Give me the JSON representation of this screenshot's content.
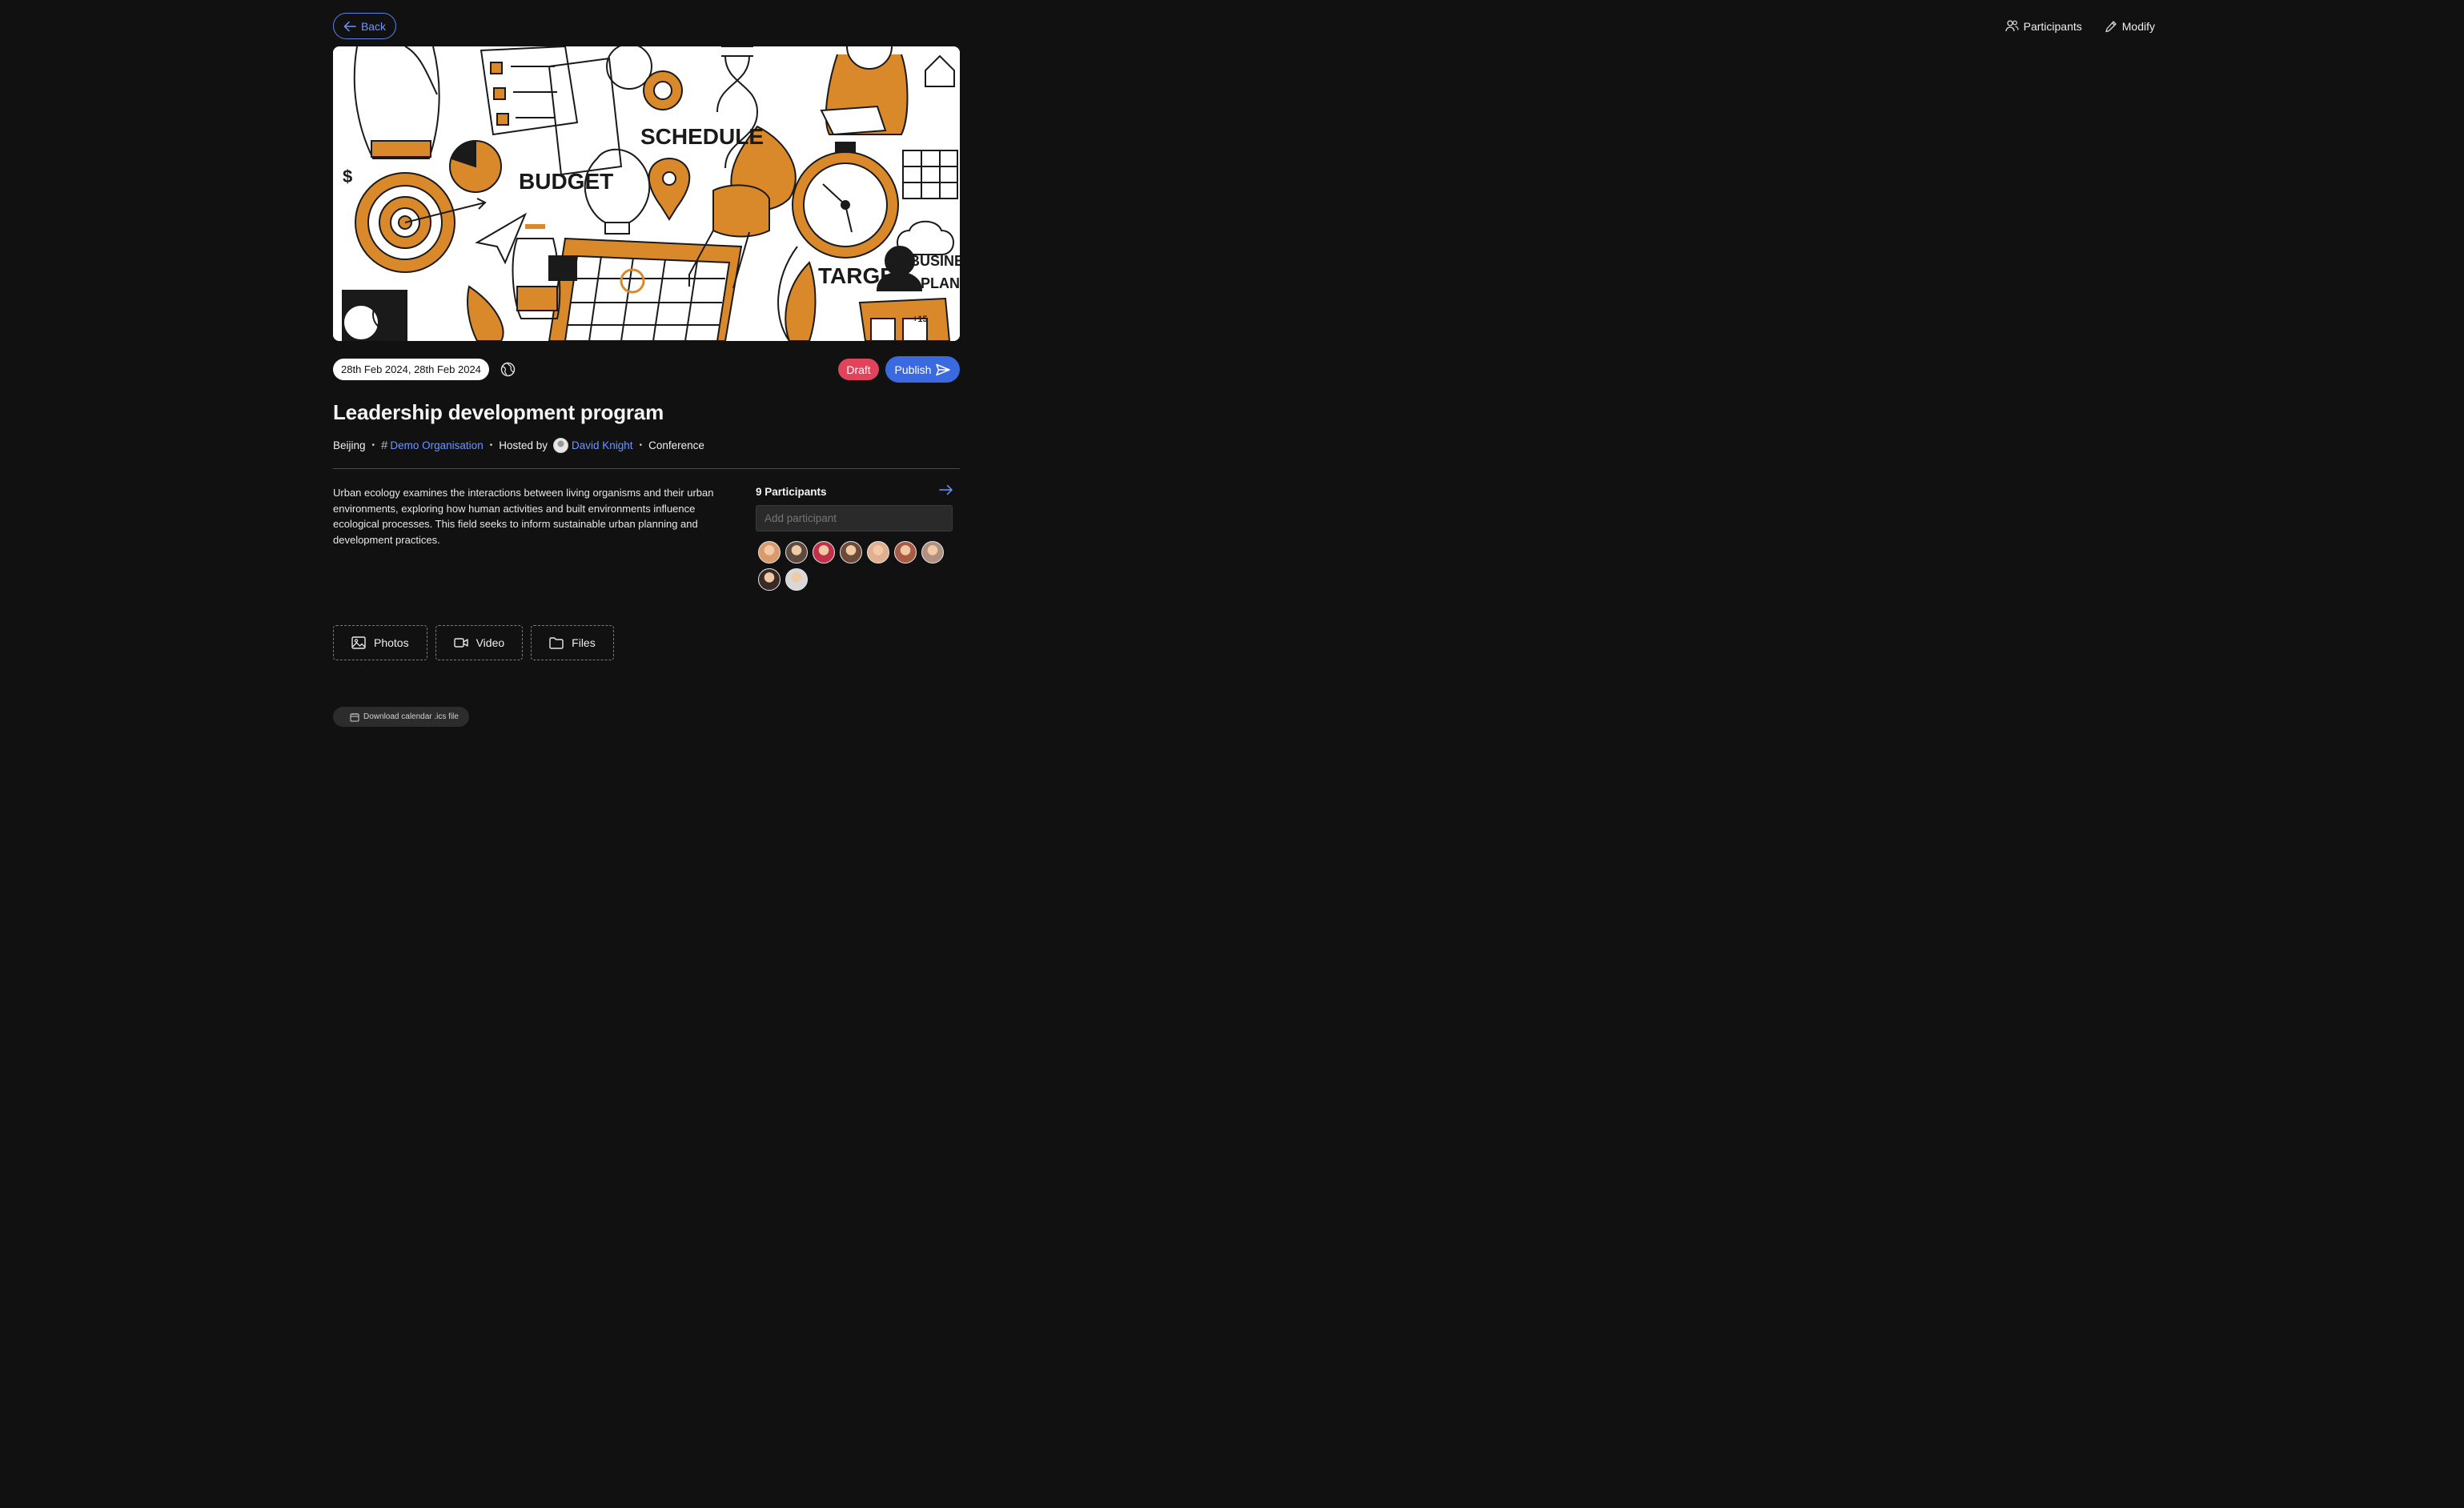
{
  "header": {
    "back_label": "Back",
    "participants_label": "Participants",
    "modify_label": "Modify"
  },
  "hero": {
    "words": [
      "SCHEDULE",
      "BUDGET",
      "TARGET",
      "BUSINESS",
      "PLAN",
      "$",
      "+15"
    ]
  },
  "event": {
    "date_range": "28th Feb 2024, 28th Feb 2024",
    "status": "Draft",
    "publish_label": "Publish",
    "title": "Leadership development program",
    "location": "Beijing",
    "organisation": "Demo Organisation",
    "hosted_by_label": "Hosted by",
    "host_name": "David Knight",
    "event_type": "Conference",
    "description": "Urban ecology examines the interactions between living organisms and their urban environments, exploring how human activities and built environments influence ecological processes. This field seeks to inform sustainable urban planning and development practices."
  },
  "participants": {
    "title": "9 Participants",
    "add_placeholder": "Add participant",
    "avatar_colors": [
      "#d99a6c",
      "#5a4a40",
      "#c0304a",
      "#6b4a3a",
      "#e0b090",
      "#a85a45",
      "#b09080",
      "#3a2a25",
      "#d8d8d8"
    ]
  },
  "media": {
    "photos_label": "Photos",
    "video_label": "Video",
    "files_label": "Files"
  },
  "calendar": {
    "ics_label": "Download calendar .ics file"
  },
  "colors": {
    "background": "#111111",
    "accent_blue": "#3b6ae0",
    "link_blue": "#6d95ff",
    "draft_red": "#e0435c",
    "hero_orange": "#d9892a"
  }
}
